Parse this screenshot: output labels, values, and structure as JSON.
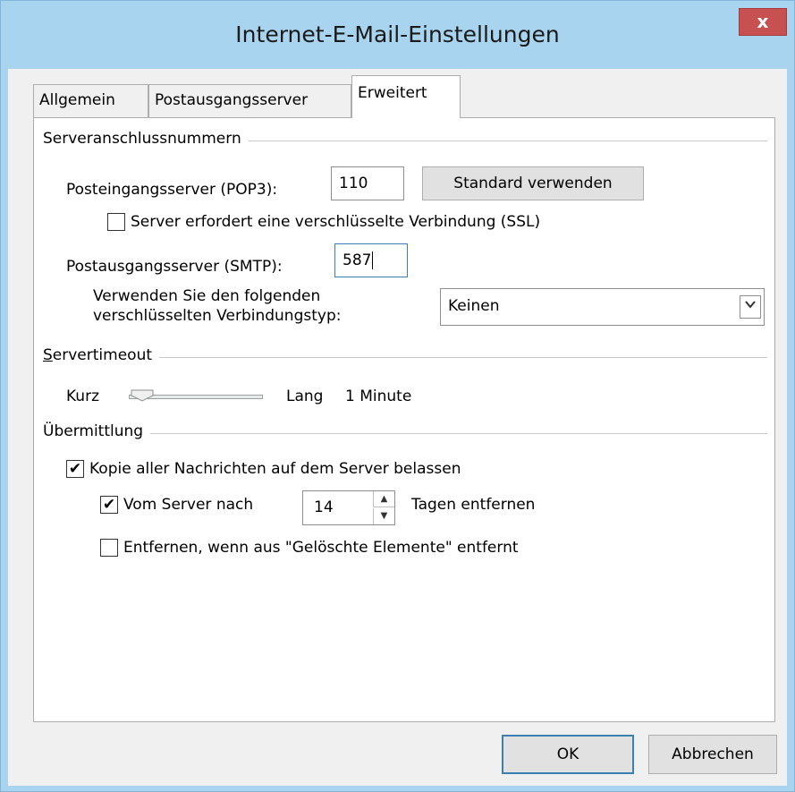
{
  "window": {
    "title": "Internet-E-Mail-Einstellungen",
    "close_label": "x"
  },
  "tabs": [
    {
      "label": "Allgemein"
    },
    {
      "label": "Postausgangsserver"
    },
    {
      "label": "Erweitert"
    }
  ],
  "ports": {
    "group_title": "Serveranschlussnummern",
    "pop3_label": "Posteingangsserver (POP3):",
    "pop3_value": "110",
    "default_button": "Standard verwenden",
    "ssl_label": "Server erfordert eine verschlüsselte Verbindung (SSL)",
    "ssl_checked": false,
    "smtp_label": "Postausgangsserver (SMTP):",
    "smtp_value": "587",
    "enc_label_line1": "Verwenden Sie den folgenden",
    "enc_label_line2": "verschlüsselten Verbindungstyp:",
    "enc_value": "Keinen"
  },
  "timeout": {
    "group_title": "Servertimeout",
    "short_label": "Kurz",
    "long_label": "Lang",
    "value_text": "1 Minute",
    "slider_level": 0.1
  },
  "delivery": {
    "group_title": "Übermittlung",
    "keep_copy_label": "Kopie aller Nachrichten auf dem Server belassen",
    "keep_copy_checked": true,
    "remove_after_label": "Vom Server nach",
    "remove_after_checked": true,
    "days_value": "14",
    "days_suffix": "Tagen entfernen",
    "remove_deleted_label": "Entfernen, wenn aus \"Gelöschte Elemente\" entfernt",
    "remove_deleted_checked": false
  },
  "footer": {
    "ok_label": "OK",
    "cancel_label": "Abbrechen"
  },
  "colors": {
    "accent": "#3c7fb1",
    "title_bar": "#a9d4ef",
    "close": "#c75050"
  }
}
